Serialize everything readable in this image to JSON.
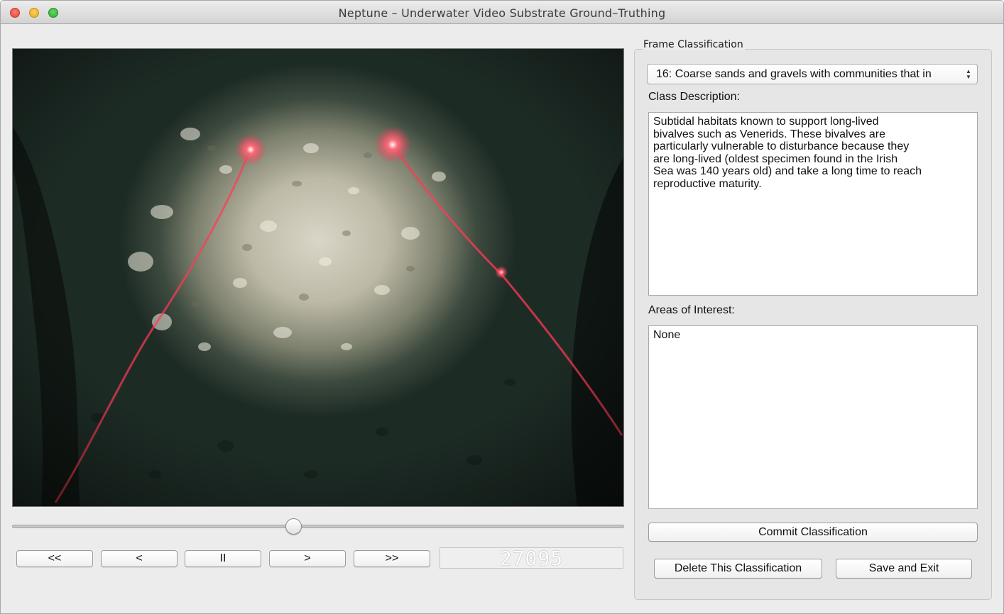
{
  "window": {
    "title": "Neptune – Underwater Video Substrate Ground–Truthing"
  },
  "player": {
    "buttons": {
      "rewind_fast": "<<",
      "step_back": "<",
      "pause": "II",
      "step_forward": ">",
      "forward_fast": ">>"
    },
    "frame_number": "27095",
    "position_fraction": 0.46
  },
  "classification": {
    "group_title": "Frame Classification",
    "selected_class": "16: Coarse sands and gravels with communities that in",
    "class_description_label": "Class Description:",
    "class_description": "Subtidal habitats known to support long-lived\nbivalves such as Venerids. These bivalves are\nparticularly vulnerable to disturbance because they\nare long-lived (oldest specimen found in the Irish\nSea was 140 years old) and take a long time to reach\nreproductive maturity.",
    "areas_of_interest_label": "Areas of Interest:",
    "areas_of_interest": "None",
    "commit_button": "Commit Classification",
    "delete_button": "Delete This Classification",
    "save_exit_button": "Save and Exit"
  }
}
